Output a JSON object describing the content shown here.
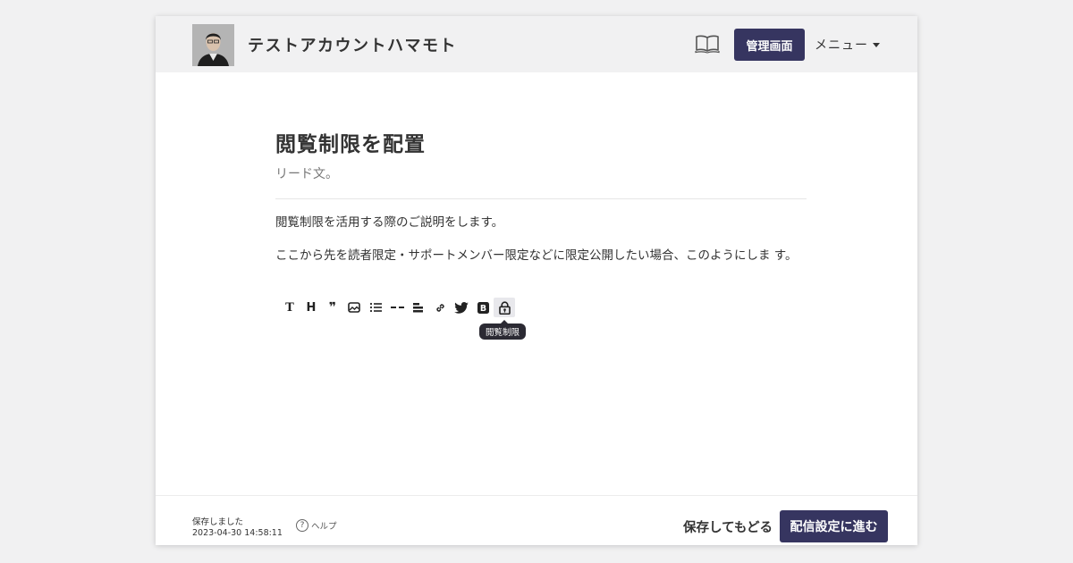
{
  "header": {
    "account_name": "テストアカウントハマモト",
    "admin_label": "管理画面",
    "menu_label": "メニュー"
  },
  "article": {
    "title": "閲覧制限を配置",
    "lead": "リード文。",
    "paragraphs": [
      "閲覧制限を活用する際のご説明をします。",
      "ここから先を読者限定・サポートメンバー限定などに限定公開したい場合、このようにしま す。"
    ]
  },
  "toolbar": {
    "items": [
      {
        "name": "text",
        "glyph": "T"
      },
      {
        "name": "heading",
        "glyph": "H"
      },
      {
        "name": "quote",
        "glyph": "❞"
      },
      {
        "name": "image",
        "icon": "image-icon"
      },
      {
        "name": "list",
        "icon": "list-icon"
      },
      {
        "name": "divider",
        "icon": "divider-icon"
      },
      {
        "name": "align",
        "icon": "align-icon"
      },
      {
        "name": "link",
        "icon": "link-icon"
      },
      {
        "name": "twitter",
        "icon": "twitter-icon"
      },
      {
        "name": "bold-box",
        "glyph": "B"
      },
      {
        "name": "access-restriction",
        "icon": "lock-icon"
      }
    ],
    "tooltip": "閲覧制限"
  },
  "footer": {
    "saved_label": "保存しました",
    "saved_time": "2023-04-30 14:58:11",
    "help_label": "ヘルプ",
    "save_back_label": "保存してもどる",
    "next_label": "配信設定に進む"
  },
  "colors": {
    "primary": "#363560",
    "header_bg": "#f1f1f2",
    "page_bg": "#f1f1f2"
  }
}
